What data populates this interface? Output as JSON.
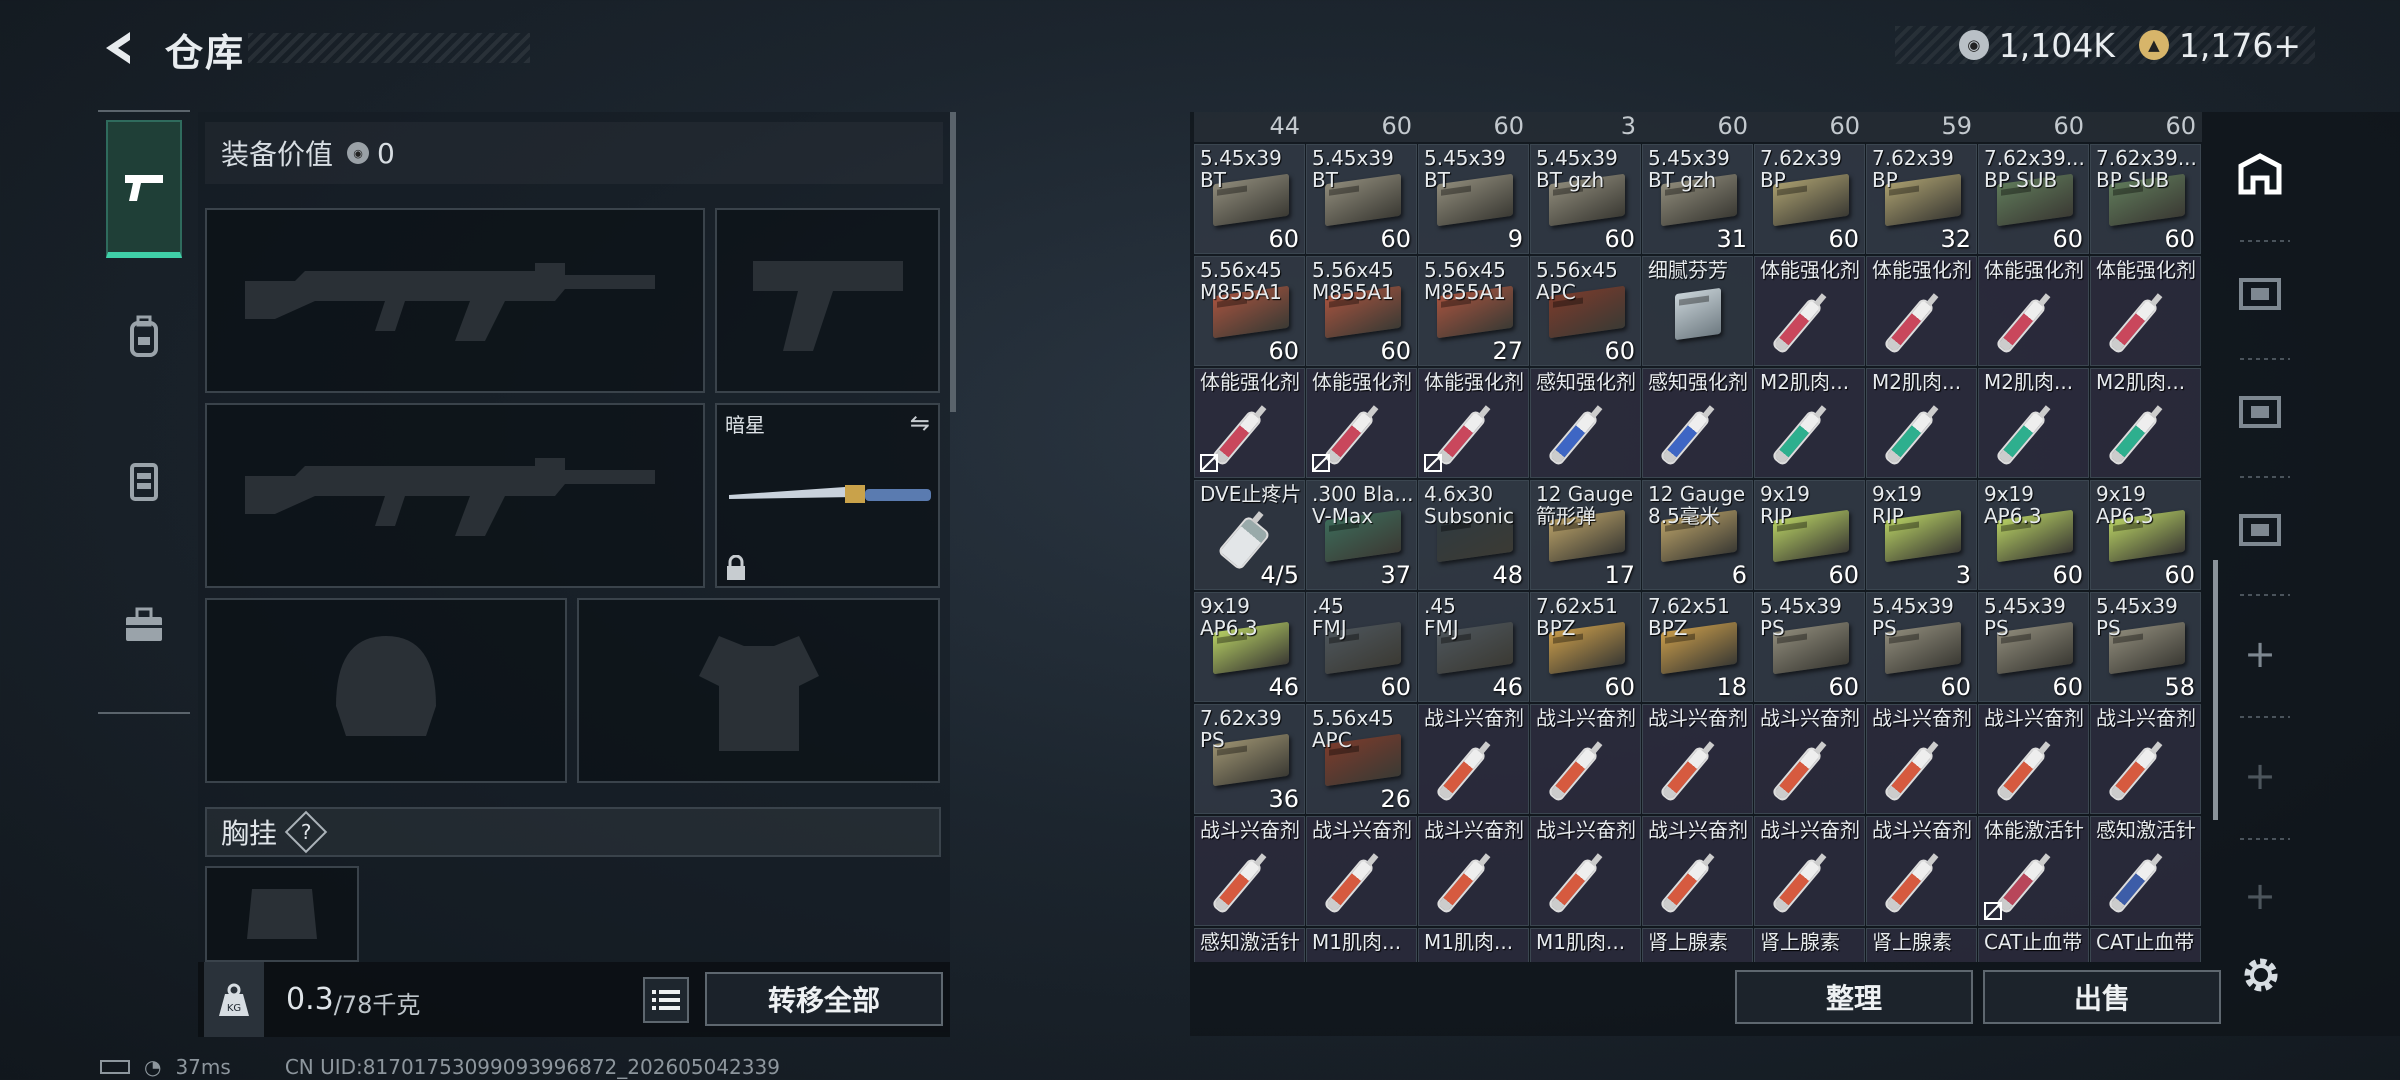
{
  "header": {
    "title": "仓库"
  },
  "currency": [
    {
      "icon": "silver-coin-icon",
      "value": "1,104K"
    },
    {
      "icon": "gold-coin-icon",
      "value": "1,176+"
    }
  ],
  "leftnav": [
    {
      "icon": "pistol-icon",
      "active": true
    },
    {
      "icon": "backpack-icon",
      "active": false
    },
    {
      "icon": "vest-icon",
      "active": false
    },
    {
      "icon": "toolbox-icon",
      "active": false
    }
  ],
  "loadout": {
    "equip_value_label": "装备价值",
    "equip_value": "0",
    "melee_name": "暗星",
    "chest_rig_label": "胸挂",
    "help_glyph": "?",
    "weight_current": "0.3",
    "weight_max": "/78千克",
    "weight_icon_text": "KG",
    "transfer_all": "转移全部"
  },
  "inventory": {
    "top_partial_counts": [
      "44",
      "60",
      "60",
      "3",
      "60",
      "60",
      "59",
      "60",
      "60"
    ],
    "rows": [
      [
        {
          "name": "5.45x39\nBT",
          "count": "60",
          "type": "ammo",
          "color": "#8e8a7a"
        },
        {
          "name": "5.45x39\nBT",
          "count": "60",
          "type": "ammo",
          "color": "#8e8a7a"
        },
        {
          "name": "5.45x39\nBT",
          "count": "9",
          "type": "ammo",
          "color": "#8e8a7a"
        },
        {
          "name": "5.45x39\nBT gzh",
          "count": "60",
          "type": "ammo",
          "color": "#8e8a7a"
        },
        {
          "name": "5.45x39\nBT gzh",
          "count": "31",
          "type": "ammo",
          "color": "#8e8a7a"
        },
        {
          "name": "7.62x39\nBP",
          "count": "60",
          "type": "ammo",
          "color": "#a89d6e"
        },
        {
          "name": "7.62x39\nBP",
          "count": "32",
          "type": "ammo",
          "color": "#a89d6e"
        },
        {
          "name": "7.62x39...\nBP SUB",
          "count": "60",
          "type": "ammo",
          "color": "#5f7a5a"
        },
        {
          "name": "7.62x39...\nBP SUB",
          "count": "60",
          "type": "ammo",
          "color": "#5f7a5a"
        }
      ],
      [
        {
          "name": "5.56x45\nM855A1",
          "count": "60",
          "type": "ammo",
          "color": "#a5533f"
        },
        {
          "name": "5.56x45\nM855A1",
          "count": "60",
          "type": "ammo",
          "color": "#a5533f"
        },
        {
          "name": "5.56x45\nM855A1",
          "count": "27",
          "type": "ammo",
          "color": "#a5533f"
        },
        {
          "name": "5.56x45\nAPC",
          "count": "60",
          "type": "ammo",
          "color": "#7a3b2c"
        },
        {
          "name": "细腻芬芳",
          "count": "",
          "type": "glass",
          "color": "#9aa6ad"
        },
        {
          "name": "体能强化剂",
          "count": "",
          "type": "syringe",
          "color": "#c9475c"
        },
        {
          "name": "体能强化剂",
          "count": "",
          "type": "syringe",
          "color": "#c9475c"
        },
        {
          "name": "体能强化剂",
          "count": "",
          "type": "syringe",
          "color": "#c9475c"
        },
        {
          "name": "体能强化剂",
          "count": "",
          "type": "syringe",
          "color": "#c9475c"
        }
      ],
      [
        {
          "name": "体能强化剂",
          "count": "",
          "type": "syringe",
          "color": "#c9475c",
          "lock": true
        },
        {
          "name": "体能强化剂",
          "count": "",
          "type": "syringe",
          "color": "#c9475c",
          "lock": true
        },
        {
          "name": "体能强化剂",
          "count": "",
          "type": "syringe",
          "color": "#c9475c",
          "lock": true
        },
        {
          "name": "感知强化剂",
          "count": "",
          "type": "syringe",
          "color": "#3e66c4"
        },
        {
          "name": "感知强化剂",
          "count": "",
          "type": "syringe",
          "color": "#3e66c4"
        },
        {
          "name": "M2肌肉...",
          "count": "",
          "type": "syringe",
          "color": "#2eaf8e"
        },
        {
          "name": "M2肌肉...",
          "count": "",
          "type": "syringe",
          "color": "#2eaf8e"
        },
        {
          "name": "M2肌肉...",
          "count": "",
          "type": "syringe",
          "color": "#2eaf8e"
        },
        {
          "name": "M2肌肉...",
          "count": "",
          "type": "syringe",
          "color": "#2eaf8e"
        }
      ],
      [
        {
          "name": "DVE止疼片",
          "count": "4/5",
          "type": "pills",
          "color": "#c8ccd0"
        },
        {
          "name": ".300 Bla...\nV-Max",
          "count": "37",
          "type": "ammo",
          "color": "#3d6b5a"
        },
        {
          "name": "4.6x30\nSubsonic",
          "count": "48",
          "type": "ammo",
          "color": "#2f3a40"
        },
        {
          "name": "12 Gauge\n箭形弹",
          "count": "17",
          "type": "ammo",
          "color": "#b8a067"
        },
        {
          "name": "12 Gauge\n8.5毫米",
          "count": "6",
          "type": "ammo",
          "color": "#b8a067"
        },
        {
          "name": "9x19\nRIP",
          "count": "60",
          "type": "ammo",
          "color": "#b6cf63"
        },
        {
          "name": "9x19\nRIP",
          "count": "3",
          "type": "ammo",
          "color": "#b6cf63"
        },
        {
          "name": "9x19\nAP6.3",
          "count": "60",
          "type": "ammo",
          "color": "#b6cf63"
        },
        {
          "name": "9x19\nAP6.3",
          "count": "60",
          "type": "ammo",
          "color": "#b6cf63"
        }
      ],
      [
        {
          "name": "9x19\nAP6.3",
          "count": "46",
          "type": "ammo",
          "color": "#b6cf63"
        },
        {
          "name": ".45\nFMJ",
          "count": "60",
          "type": "ammo",
          "color": "#4d555b"
        },
        {
          "name": ".45\nFMJ",
          "count": "46",
          "type": "ammo",
          "color": "#4d555b"
        },
        {
          "name": "7.62x51\nBPZ",
          "count": "60",
          "type": "ammo",
          "color": "#c79b4a"
        },
        {
          "name": "7.62x51\nBPZ",
          "count": "18",
          "type": "ammo",
          "color": "#c79b4a"
        },
        {
          "name": "5.45x39\nPS",
          "count": "60",
          "type": "ammo",
          "color": "#8e8a7a"
        },
        {
          "name": "5.45x39\nPS",
          "count": "60",
          "type": "ammo",
          "color": "#8e8a7a"
        },
        {
          "name": "5.45x39\nPS",
          "count": "60",
          "type": "ammo",
          "color": "#8e8a7a"
        },
        {
          "name": "5.45x39\nPS",
          "count": "58",
          "type": "ammo",
          "color": "#8e8a7a"
        }
      ],
      [
        {
          "name": "7.62x39\nPS",
          "count": "36",
          "type": "ammo",
          "color": "#9b9170"
        },
        {
          "name": "5.56x45\nAPC",
          "count": "26",
          "type": "ammo",
          "color": "#7a3b2c"
        },
        {
          "name": "战斗兴奋剂",
          "count": "",
          "type": "syringe",
          "color": "#d65a3f"
        },
        {
          "name": "战斗兴奋剂",
          "count": "",
          "type": "syringe",
          "color": "#d65a3f"
        },
        {
          "name": "战斗兴奋剂",
          "count": "",
          "type": "syringe",
          "color": "#d65a3f"
        },
        {
          "name": "战斗兴奋剂",
          "count": "",
          "type": "syringe",
          "color": "#d65a3f"
        },
        {
          "name": "战斗兴奋剂",
          "count": "",
          "type": "syringe",
          "color": "#d65a3f"
        },
        {
          "name": "战斗兴奋剂",
          "count": "",
          "type": "syringe",
          "color": "#d65a3f"
        },
        {
          "name": "战斗兴奋剂",
          "count": "",
          "type": "syringe",
          "color": "#d65a3f"
        }
      ],
      [
        {
          "name": "战斗兴奋剂",
          "count": "",
          "type": "syringe",
          "color": "#d65a3f"
        },
        {
          "name": "战斗兴奋剂",
          "count": "",
          "type": "syringe",
          "color": "#d65a3f"
        },
        {
          "name": "战斗兴奋剂",
          "count": "",
          "type": "syringe",
          "color": "#d65a3f"
        },
        {
          "name": "战斗兴奋剂",
          "count": "",
          "type": "syringe",
          "color": "#d65a3f"
        },
        {
          "name": "战斗兴奋剂",
          "count": "",
          "type": "syringe",
          "color": "#d65a3f"
        },
        {
          "name": "战斗兴奋剂",
          "count": "",
          "type": "syringe",
          "color": "#d65a3f"
        },
        {
          "name": "战斗兴奋剂",
          "count": "",
          "type": "syringe",
          "color": "#d65a3f"
        },
        {
          "name": "体能激活针",
          "count": "",
          "type": "syringe",
          "color": "#b8465a",
          "lock": true
        },
        {
          "name": "感知激活针",
          "count": "",
          "type": "syringe",
          "color": "#3d5da8"
        }
      ],
      [
        {
          "name": "感知激活针",
          "count": "",
          "type": "syringe",
          "color": "#3d5da8"
        },
        {
          "name": "M1肌肉...",
          "count": "",
          "type": "syringe",
          "color": "#2eaf8e"
        },
        {
          "name": "M1肌肉...",
          "count": "",
          "type": "syringe",
          "color": "#2eaf8e"
        },
        {
          "name": "M1肌肉...",
          "count": "",
          "type": "syringe",
          "color": "#2eaf8e"
        },
        {
          "name": "肾上腺素",
          "count": "",
          "type": "syringe",
          "color": "#d6a43f"
        },
        {
          "name": "肾上腺素",
          "count": "",
          "type": "syringe",
          "color": "#d6a43f"
        },
        {
          "name": "肾上腺素",
          "count": "",
          "type": "syringe",
          "color": "#d6a43f"
        },
        {
          "name": "CAT止血带",
          "count": "",
          "type": "syringe",
          "color": "#777"
        },
        {
          "name": "CAT止血带",
          "count": "",
          "type": "syringe",
          "color": "#777"
        }
      ]
    ],
    "organize": "整理",
    "sell": "出售"
  },
  "sidebar_right": [
    {
      "icon": "stash-icon",
      "selected": true
    },
    {
      "icon": "container-2-icon",
      "selected": false
    },
    {
      "icon": "container-4-icon",
      "selected": false
    },
    {
      "icon": "container-3-icon",
      "selected": false
    },
    {
      "icon": "add-icon",
      "selected": false
    },
    {
      "icon": "add-icon",
      "selected": false
    },
    {
      "icon": "add-icon",
      "selected": false
    }
  ],
  "status": {
    "ping": "37ms",
    "uid": "CN UID:8170175309909399687​2_202605042339"
  }
}
